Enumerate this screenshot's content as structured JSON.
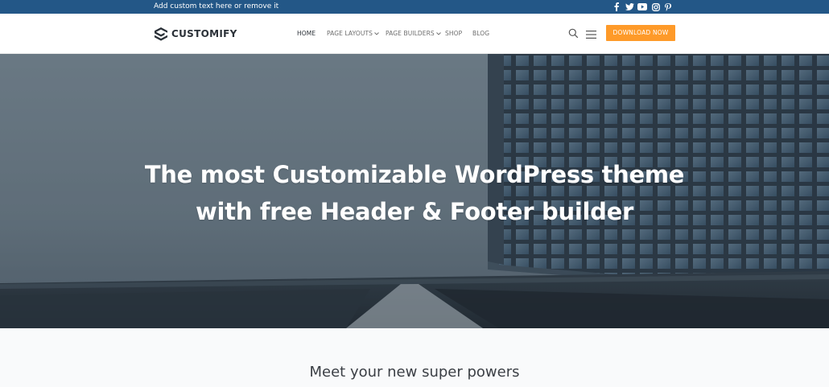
{
  "topbar": {
    "text": "Add custom text here or remove it",
    "social_icons": [
      "facebook-icon",
      "twitter-icon",
      "youtube-icon",
      "instagram-icon",
      "pinterest-icon"
    ],
    "background": "#235787"
  },
  "header": {
    "logo_text": "CUSTOMIFY",
    "nav": [
      {
        "label": "HOME",
        "active": true,
        "dropdown": false
      },
      {
        "label": "PAGE LAYOUTS",
        "active": false,
        "dropdown": true
      },
      {
        "label": "PAGE BUILDERS",
        "active": false,
        "dropdown": true
      },
      {
        "label": "SHOP",
        "active": false,
        "dropdown": false
      },
      {
        "label": "BLOG",
        "active": false,
        "dropdown": false
      }
    ],
    "cta_label": "DOWNLOAD NOW",
    "cta_color": "#fe9a29"
  },
  "hero": {
    "title_line1": "The most Customizable WordPress theme",
    "title_line2": "with free Header & Footer builder"
  },
  "section": {
    "title": "Meet your new super powers"
  }
}
